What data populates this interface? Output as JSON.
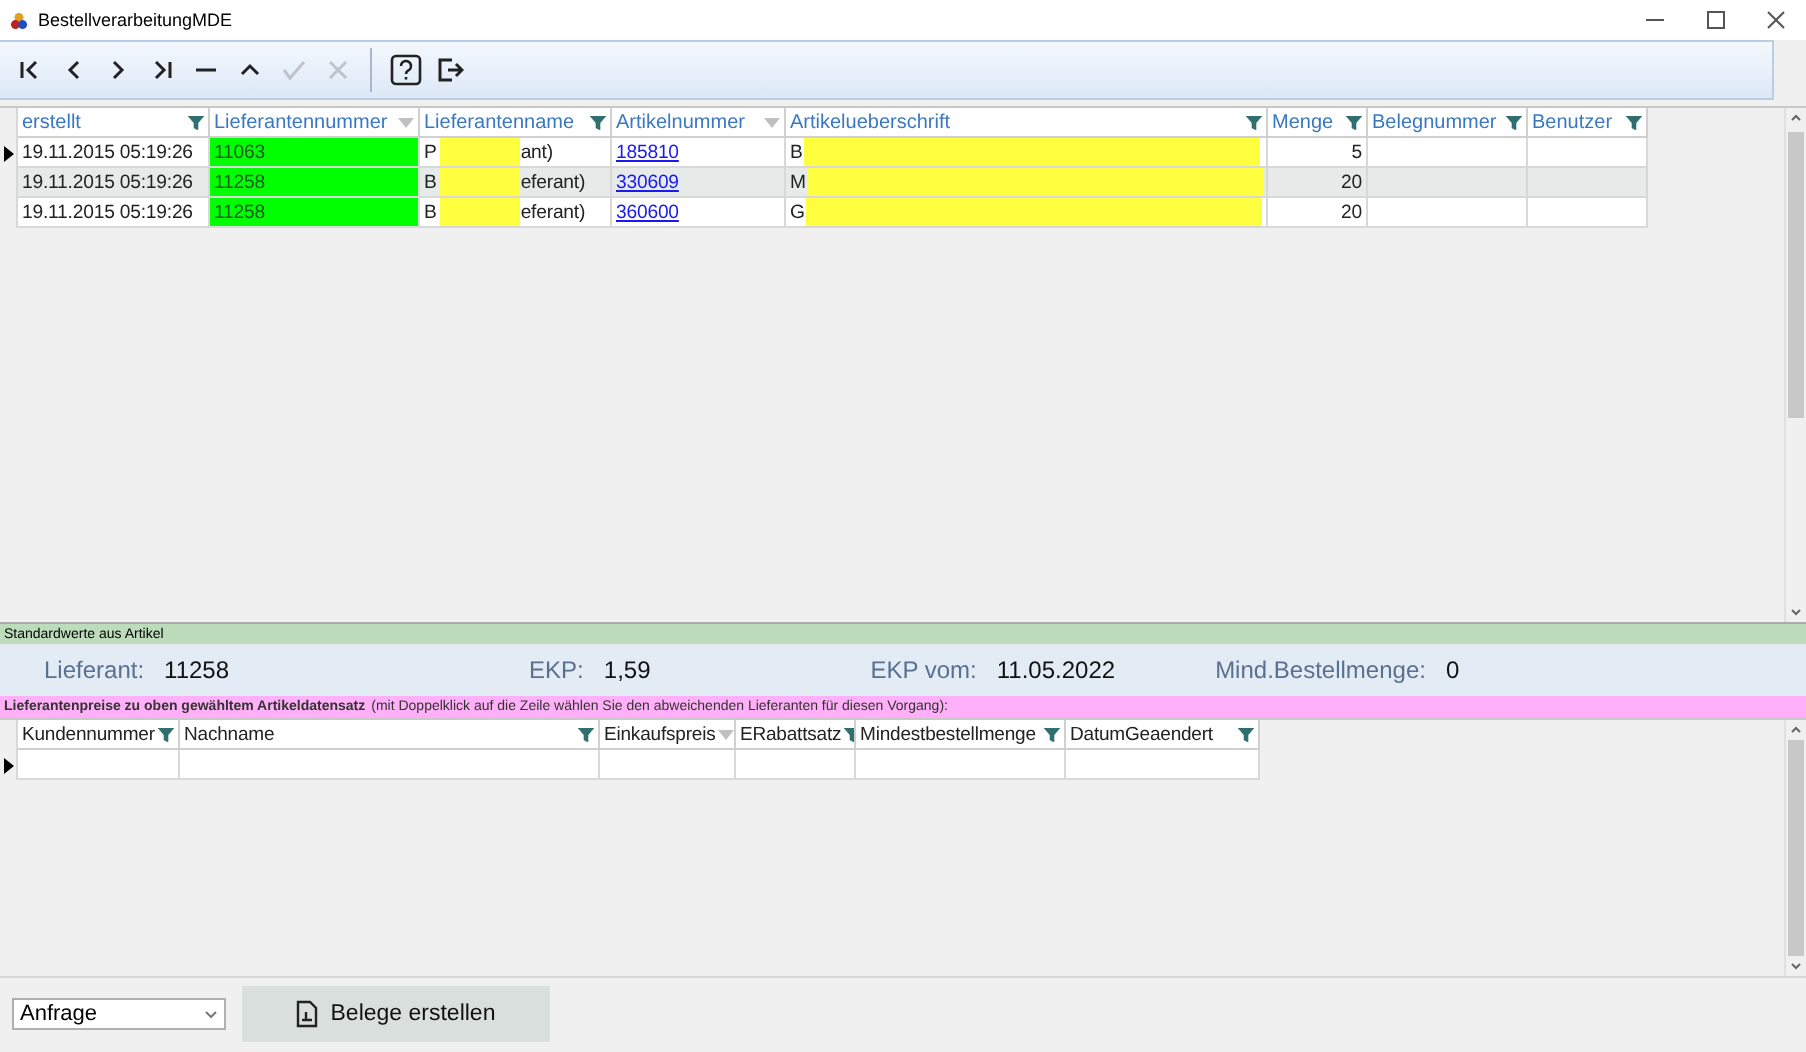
{
  "window": {
    "title": "BestellverarbeitungMDE"
  },
  "toolbar": [
    {
      "kind": "first",
      "disabled": false
    },
    {
      "kind": "prev",
      "disabled": false
    },
    {
      "kind": "next",
      "disabled": false
    },
    {
      "kind": "last",
      "disabled": false
    },
    {
      "kind": "delete",
      "disabled": false
    },
    {
      "kind": "up",
      "disabled": false
    },
    {
      "kind": "confirm",
      "disabled": true
    },
    {
      "kind": "cancel",
      "disabled": true
    },
    {
      "kind": "separator"
    },
    {
      "kind": "help",
      "disabled": false
    },
    {
      "kind": "exit",
      "disabled": false
    }
  ],
  "orders_table": {
    "columns": [
      {
        "label": "erstellt",
        "kind": "text",
        "filter_active": true
      },
      {
        "label": "Lieferantennummer",
        "kind": "supplier",
        "filter_active": false
      },
      {
        "label": "Lieferantenname",
        "kind": "redacted",
        "filter_active": true
      },
      {
        "label": "Artikelnummer",
        "kind": "link",
        "filter_active": false
      },
      {
        "label": "Artikelueberschrift",
        "kind": "redacted",
        "filter_active": true
      },
      {
        "label": "Menge",
        "kind": "number",
        "filter_active": true
      },
      {
        "label": "Belegnummer",
        "filter_active": true
      },
      {
        "label": "Benutzer",
        "filter_active": true
      }
    ],
    "rows": [
      {
        "current": true,
        "cells": [
          {
            "text": "19.11.2015 05:19:26"
          },
          {
            "text": "11063",
            "color": "#00ff00"
          },
          {
            "start": "P",
            "end": "ant)",
            "redacted": true
          },
          {
            "text": "185810"
          },
          {
            "start": "B",
            "redacted": true
          },
          {
            "text": "5"
          }
        ]
      },
      {
        "current": false,
        "cells": [
          {
            "text": "19.11.2015 05:19:26"
          },
          {
            "text": "11258",
            "color": "#00ff00"
          },
          {
            "start": "B",
            "end": "eferant)",
            "redacted": true
          },
          {
            "text": "330609"
          },
          {
            "start": "M",
            "redacted": true
          },
          {
            "text": "20"
          }
        ]
      },
      {
        "current": false,
        "cells": [
          {
            "text": "19.11.2015 05:19:26"
          },
          {
            "text": "11258",
            "color": "#00ff00"
          },
          {
            "start": "B",
            "end": "eferant)",
            "redacted": true
          },
          {
            "text": "360600"
          },
          {
            "start": "G",
            "redacted": true
          },
          {
            "text": "20"
          }
        ]
      }
    ]
  },
  "defaults_bar": {
    "title": "Standardwerte aus Artikel"
  },
  "defaults": [
    {
      "label": "Lieferant:",
      "value": "11258"
    },
    {
      "label": "EKP:",
      "value": "1,59"
    },
    {
      "label": "EKP vom:",
      "value": "11.05.2022"
    },
    {
      "label": "Mind.Bestellmenge:",
      "value": "0"
    }
  ],
  "prices_bar": {
    "title": "Lieferantenpreise zu oben gewähltem Artikeldatensatz",
    "note": "(mit Doppelklick auf die Zeile wählen Sie den abweichenden Lieferanten für diesen  Vorgang):"
  },
  "prices_table": {
    "columns": [
      {
        "label": "Kundennummer",
        "filter_active": true
      },
      {
        "label": "Nachname",
        "filter_active": true
      },
      {
        "label": "Einkaufspreis",
        "filter_active": false
      },
      {
        "label": "ERabattsatz",
        "filter_active": true
      },
      {
        "label": "Mindestbestellmenge",
        "filter_active": true
      },
      {
        "label": "DatumGeaendert",
        "filter_active": true
      }
    ],
    "rows": [
      {
        "current": true
      }
    ]
  },
  "document_type": {
    "value": "Anfrage"
  },
  "create_button": {
    "label": "Belege erstellen"
  }
}
